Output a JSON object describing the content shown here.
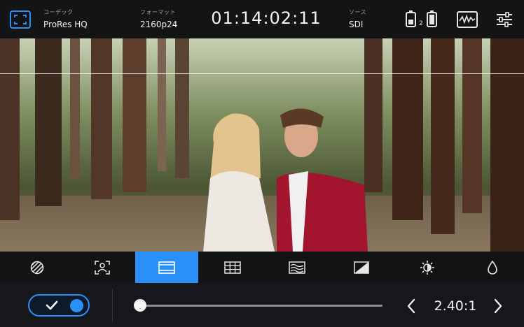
{
  "topbar": {
    "codec_label": "コーデック",
    "codec_value": "ProRes HQ",
    "format_label": "フォーマット",
    "format_value": "2160p24",
    "timecode": "01:14:02:11",
    "source_label": "ソース",
    "source_value": "SDI",
    "battery_slot_number": "2"
  },
  "tools": [
    {
      "name": "zebra",
      "icon": "zebra-icon"
    },
    {
      "name": "focus-assist",
      "icon": "focus-assist-icon"
    },
    {
      "name": "frame-guides",
      "icon": "frame-guides-icon",
      "active": true
    },
    {
      "name": "grids",
      "icon": "grid-icon"
    },
    {
      "name": "false-color",
      "icon": "false-color-icon"
    },
    {
      "name": "lut",
      "icon": "lut-icon"
    },
    {
      "name": "brightness",
      "icon": "brightness-icon"
    },
    {
      "name": "saturation",
      "icon": "saturation-icon"
    }
  ],
  "bottom": {
    "toggle_on": true,
    "slider_level": 0.0,
    "aspect_ratio": "2.40:1"
  },
  "colors": {
    "accent": "#2a8ff7",
    "bar_bg": "#121416"
  }
}
